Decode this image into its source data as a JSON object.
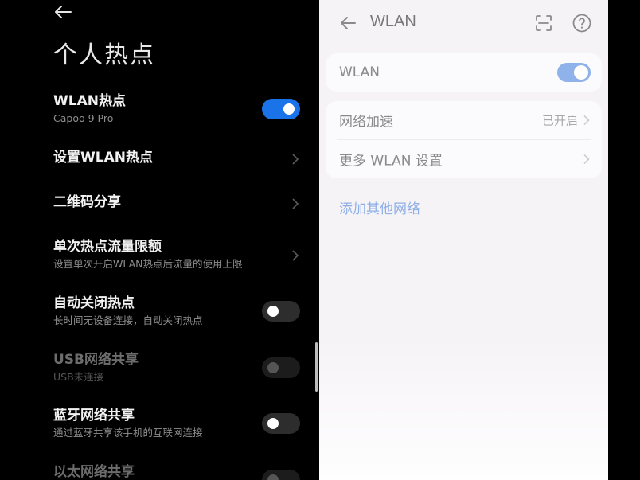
{
  "hotspot": {
    "title": "个人热点",
    "rows": [
      {
        "title": "WLAN热点",
        "sub": "Capoo 9 Pro",
        "control": "toggle",
        "state": "on"
      },
      {
        "title": "设置WLAN热点",
        "control": "chevron"
      },
      {
        "title": "二维码分享",
        "control": "chevron"
      },
      {
        "title": "单次热点流量限额",
        "sub": "设置单次开启WLAN热点后流量的使用上限",
        "control": "chevron"
      },
      {
        "title": "自动关闭热点",
        "sub": "长时间无设备连接，自动关闭热点",
        "control": "toggle",
        "state": "off"
      },
      {
        "title": "USB网络共享",
        "sub": "USB未连接",
        "control": "toggle",
        "state": "disabled"
      },
      {
        "title": "蓝牙网络共享",
        "sub": "通过蓝牙共享该手机的互联网连接",
        "control": "toggle",
        "state": "off"
      },
      {
        "title": "以太网络共享",
        "control": "toggle",
        "state": "disabled"
      }
    ]
  },
  "wlan": {
    "title": "WLAN",
    "toggle_label": "WLAN",
    "toggle_state": "on",
    "items": [
      {
        "label": "网络加速",
        "value": "已开启"
      },
      {
        "label": "更多 WLAN 设置",
        "value": ""
      }
    ],
    "add_network": "添加其他网络"
  },
  "colors": {
    "accent_dark": "#1a73e8",
    "accent_light": "#8fb2ea",
    "link": "#8fb0e6"
  },
  "icons": {
    "back": "arrow-left-icon",
    "chevron": "chevron-right-icon",
    "scan": "scan-icon",
    "help": "help-circle-icon"
  }
}
